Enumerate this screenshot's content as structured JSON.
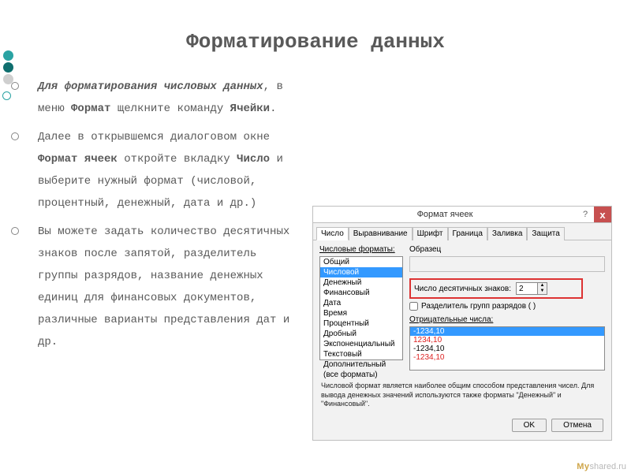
{
  "title": "Форматирование данных",
  "bullets": {
    "p1_a": "Для форматирования числовых данных",
    "p1_b": ", в меню ",
    "p1_c": "Формат",
    "p1_d": " щелкните команду ",
    "p1_e": "Ячейки",
    "p1_f": ".",
    "p2_a": "Далее в открывшемся диалоговом окне ",
    "p2_b": "Формат ячеек",
    "p2_c": " откройте вкладку ",
    "p2_d": "Число",
    "p2_e": " и выберите нужный формат (числовой, процентный, денежный, дата и др.)",
    "p3": "Вы можете задать количество десятичных знаков после запятой, разделитель группы разрядов, название денежных единиц для финансовых документов, различные варианты представления дат и др."
  },
  "dialog": {
    "title": "Формат ячеек",
    "help": "?",
    "close": "x",
    "tabs": [
      "Число",
      "Выравнивание",
      "Шрифт",
      "Граница",
      "Заливка",
      "Защита"
    ],
    "formats_label": "Числовые форматы:",
    "formats": [
      "Общий",
      "Числовой",
      "Денежный",
      "Финансовый",
      "Дата",
      "Время",
      "Процентный",
      "Дробный",
      "Экспоненциальный",
      "Текстовый",
      "Дополнительный",
      "(все форматы)"
    ],
    "formats_selected_index": 1,
    "sample_label": "Образец",
    "decimal_label": "Число десятичных знаков:",
    "decimal_value": "2",
    "thousands_label": "Разделитель групп разрядов ( )",
    "negatives_label": "Отрицательные числа:",
    "negatives": [
      "-1234,10",
      "1234,10",
      "-1234,10",
      "-1234,10"
    ],
    "negatives_red": [
      false,
      true,
      false,
      true
    ],
    "hint": "Числовой формат является наиболее общим способом представления чисел. Для вывода денежных значений используются также форматы \"Денежный\" и \"Финансовый\".",
    "ok": "OK",
    "cancel": "Отмена"
  },
  "watermark": {
    "a": "My",
    "b": "shared.ru"
  }
}
